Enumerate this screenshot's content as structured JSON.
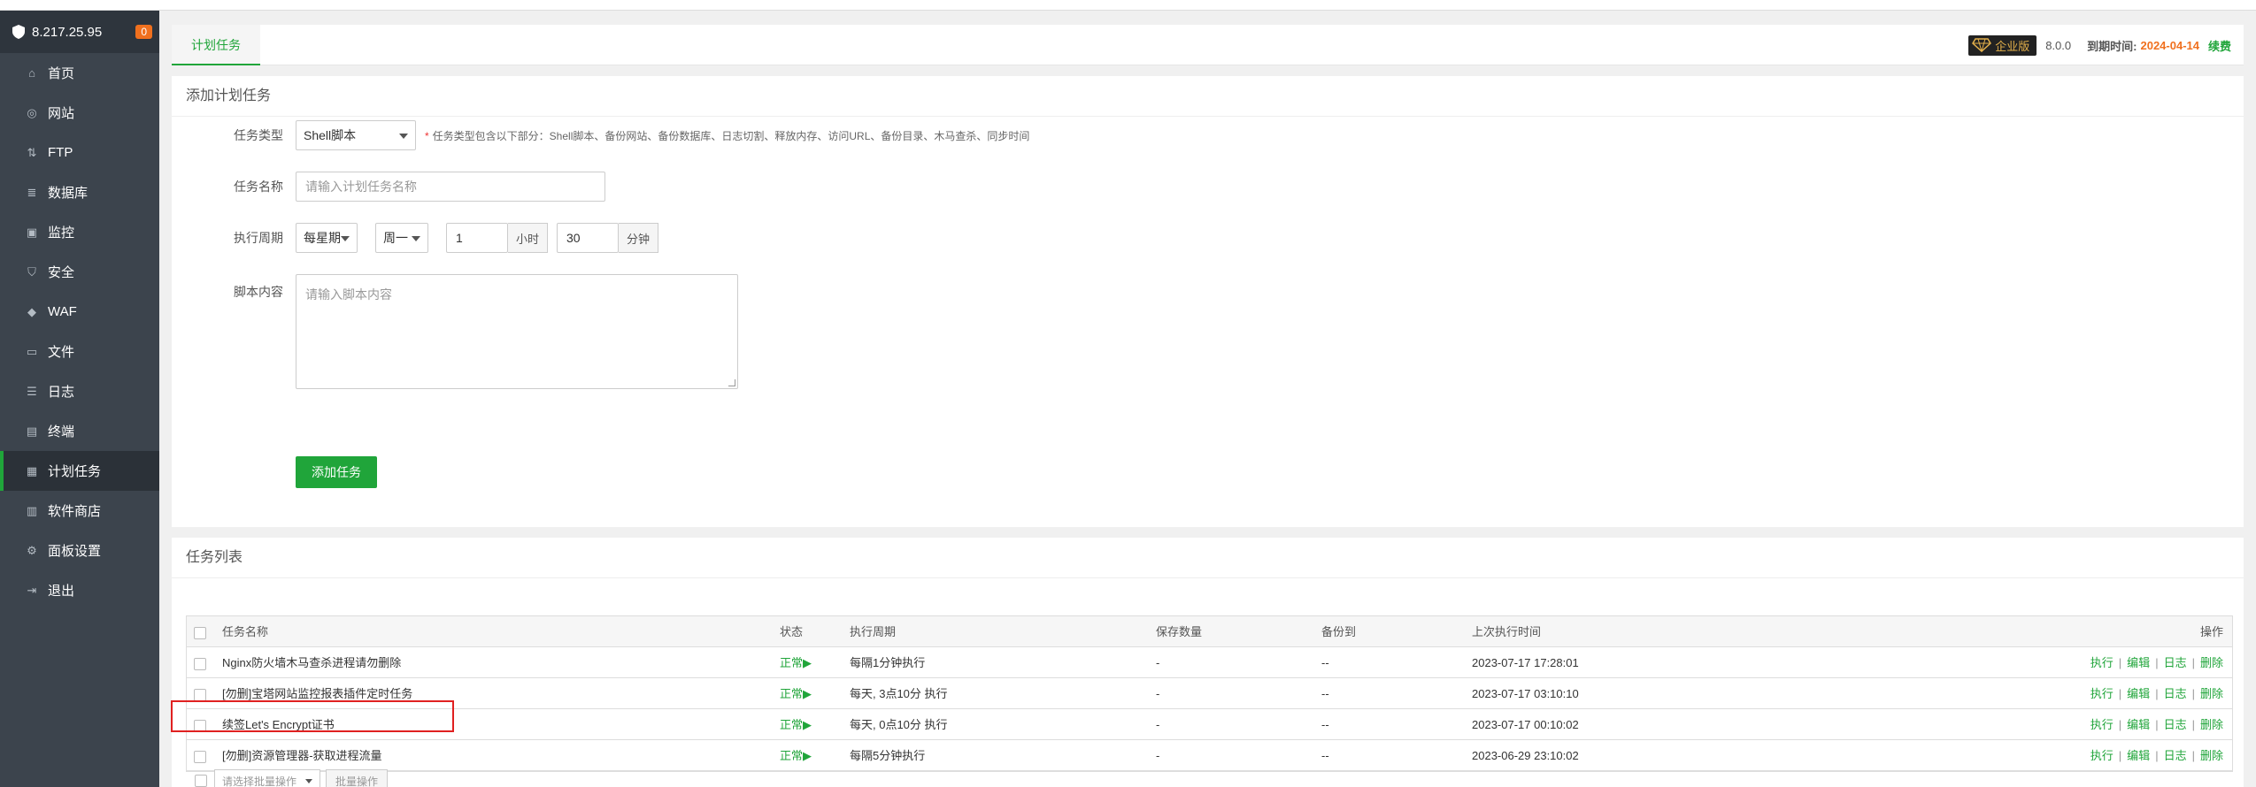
{
  "sidebar": {
    "server_ip": "8.217.25.95",
    "badge_count": "0",
    "items": [
      {
        "label": "首页",
        "icon": "home-icon"
      },
      {
        "label": "网站",
        "icon": "globe-icon"
      },
      {
        "label": "FTP",
        "icon": "ftp-icon"
      },
      {
        "label": "数据库",
        "icon": "database-icon"
      },
      {
        "label": "监控",
        "icon": "monitor-icon"
      },
      {
        "label": "安全",
        "icon": "shield-icon"
      },
      {
        "label": "WAF",
        "icon": "waf-icon"
      },
      {
        "label": "文件",
        "icon": "folder-icon"
      },
      {
        "label": "日志",
        "icon": "log-icon"
      },
      {
        "label": "终端",
        "icon": "terminal-icon"
      },
      {
        "label": "计划任务",
        "icon": "calendar-icon",
        "active": true
      },
      {
        "label": "软件商店",
        "icon": "store-icon"
      },
      {
        "label": "面板设置",
        "icon": "gear-icon"
      },
      {
        "label": "退出",
        "icon": "logout-icon"
      }
    ]
  },
  "header": {
    "tab": "计划任务",
    "edition": "企业版",
    "version": "8.0.0",
    "expire_label": "到期时间:",
    "expire_date": "2024-04-14",
    "renew": "续费"
  },
  "add_task": {
    "title": "添加计划任务",
    "type_label": "任务类型",
    "type_value": "Shell脚本",
    "type_hint": "任务类型包含以下部分：Shell脚本、备份网站、备份数据库、日志切割、释放内存、访问URL、备份目录、木马查杀、同步时间",
    "name_label": "任务名称",
    "name_placeholder": "请输入计划任务名称",
    "period_label": "执行周期",
    "period_type": "每星期",
    "weekday": "周一",
    "hour_value": "1",
    "hour_unit": "小时",
    "minute_value": "30",
    "minute_unit": "分钟",
    "script_label": "脚本内容",
    "script_placeholder": "请输入脚本内容",
    "submit": "添加任务"
  },
  "task_list": {
    "title": "任务列表",
    "columns": {
      "name": "任务名称",
      "status": "状态",
      "period": "执行周期",
      "keep": "保存数量",
      "backup": "备份到",
      "last_run": "上次执行时间",
      "ops": "操作"
    },
    "rows": [
      {
        "name": "Nginx防火墙木马查杀进程请勿删除",
        "status": "正常▶",
        "period": "每隔1分钟执行",
        "keep": "-",
        "backup": "--",
        "last_run": "2023-07-17 17:28:01"
      },
      {
        "name": "[勿删]宝塔网站监控报表插件定时任务",
        "status": "正常▶",
        "period": "每天, 3点10分 执行",
        "keep": "-",
        "backup": "--",
        "last_run": "2023-07-17 03:10:10"
      },
      {
        "name": "续签Let's Encrypt证书",
        "status": "正常▶",
        "period": "每天, 0点10分 执行",
        "keep": "-",
        "backup": "--",
        "last_run": "2023-07-17 00:10:02"
      },
      {
        "name": "[勿删]资源管理器-获取进程流量",
        "status": "正常▶",
        "period": "每隔5分钟执行",
        "keep": "-",
        "backup": "--",
        "last_run": "2023-06-29 23:10:02"
      }
    ],
    "row_actions": {
      "run": "执行",
      "edit": "编辑",
      "log": "日志",
      "delete": "删除"
    },
    "batch_placeholder": "请选择批量操作",
    "batch_button": "批量操作"
  },
  "colors": {
    "accent": "#20a53a",
    "sidebar_bg": "#3c444d",
    "highlight": "#e02020",
    "expire": "#f0701e"
  }
}
